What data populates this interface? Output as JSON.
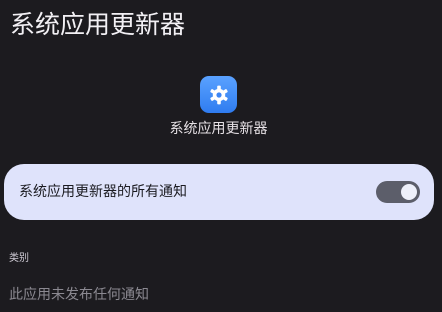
{
  "header": {
    "title": "系统应用更新器"
  },
  "app": {
    "icon": "gear-icon",
    "name": "系统应用更新器",
    "accent_color": "#2f7cf0"
  },
  "notifications": {
    "master_label": "系统应用更新器的所有通知",
    "master_enabled": true,
    "card_color": "#dfe3fb"
  },
  "categories": {
    "header": "类别",
    "empty_text": "此应用未发布任何通知"
  }
}
